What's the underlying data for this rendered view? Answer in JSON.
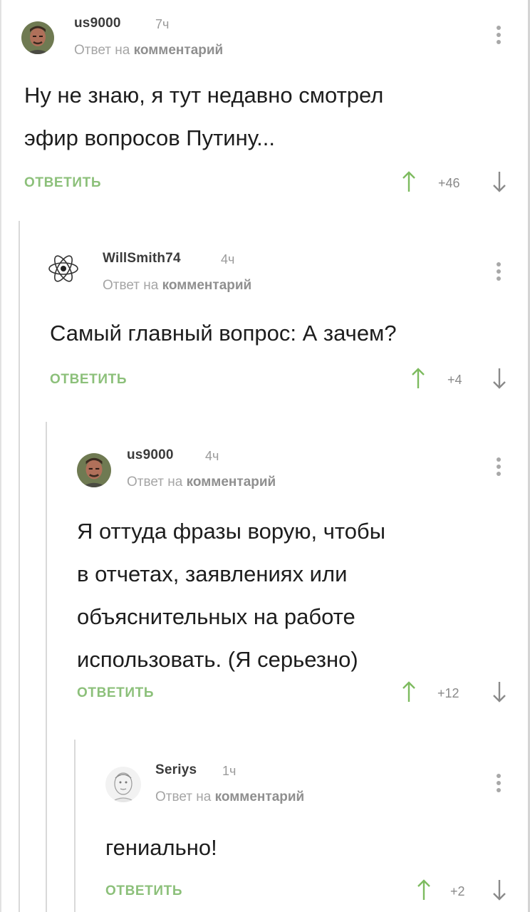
{
  "comments": [
    {
      "author": "us9000",
      "time": "7ч",
      "reply_prefix": "Ответ на",
      "reply_target": "комментарий",
      "text_lines": [
        "Ну не знаю, я тут недавно смотрел",
        "эфир вопросов Путину..."
      ],
      "reply_label": "ОТВЕТИТЬ",
      "score": "+46",
      "avatar": "man-portrait-avatar"
    },
    {
      "author": "WillSmith74",
      "time": "4ч",
      "reply_prefix": "Ответ на",
      "reply_target": "комментарий",
      "text_lines": [
        "Самый главный вопрос: А зачем?"
      ],
      "reply_label": "ОТВЕТИТЬ",
      "score": "+4",
      "avatar": "atom-icon-avatar"
    },
    {
      "author": "us9000",
      "time": "4ч",
      "reply_prefix": "Ответ на",
      "reply_target": "комментарий",
      "text_lines": [
        "Я оттуда фразы ворую, чтобы",
        "в отчетах, заявлениях или",
        "объяснительных на работе",
        "использовать. (Я серьезно)"
      ],
      "reply_label": "ОТВЕТИТЬ",
      "score": "+12",
      "avatar": "man-portrait-avatar"
    },
    {
      "author": "Seriys",
      "time": "1ч",
      "reply_prefix": "Ответ на",
      "reply_target": "комментарий",
      "text_lines": [
        "гениально!"
      ],
      "reply_label": "ОТВЕТИТЬ",
      "score": "+2",
      "avatar": "sketch-avatar"
    }
  ],
  "colors": {
    "accent_green": "#8cc07a",
    "arrow_up_green": "#7dbb5f",
    "muted_text": "#a5a5a5",
    "thread_line": "#d9d9d9"
  }
}
